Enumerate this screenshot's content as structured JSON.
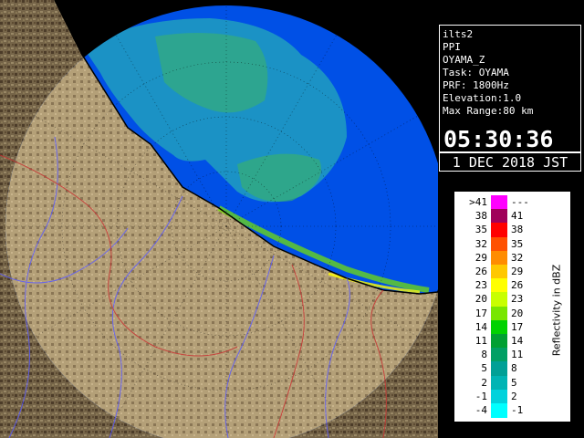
{
  "info": {
    "radar_name": "ilts2",
    "scan_type": "PPI",
    "product": "OYAMA_Z",
    "task": "Task: OYAMA",
    "prf": "PRF: 1800Hz",
    "elevation": "Elevation:1.0",
    "max_range": "Max Range:80 km",
    "time": "05:30:36",
    "date": "1 DEC 2018 JST"
  },
  "legend": {
    "title": "Reflectivity in dBZ",
    "rows": [
      {
        "left": ">41",
        "right": "---",
        "color": "#ff00ff"
      },
      {
        "left": "38",
        "right": "41",
        "color": "#a0005a"
      },
      {
        "left": "35",
        "right": "38",
        "color": "#ff0000"
      },
      {
        "left": "32",
        "right": "35",
        "color": "#ff5000"
      },
      {
        "left": "29",
        "right": "32",
        "color": "#ff8c00"
      },
      {
        "left": "26",
        "right": "29",
        "color": "#ffc800"
      },
      {
        "left": "23",
        "right": "26",
        "color": "#ffff00"
      },
      {
        "left": "20",
        "right": "23",
        "color": "#c8ff00"
      },
      {
        "left": "17",
        "right": "20",
        "color": "#78e600"
      },
      {
        "left": "14",
        "right": "17",
        "color": "#00d200"
      },
      {
        "left": "11",
        "right": "14",
        "color": "#00a032"
      },
      {
        "left": "8",
        "right": "11",
        "color": "#00a064"
      },
      {
        "left": "5",
        "right": "8",
        "color": "#00a096"
      },
      {
        "left": "2",
        "right": "5",
        "color": "#00b4b4"
      },
      {
        "left": "-1",
        "right": "2",
        "color": "#00d2dc"
      },
      {
        "left": "-4",
        "right": "-1",
        "color": "#00ffff"
      }
    ]
  },
  "colors": {
    "sea": "#0050e6",
    "land_dark": "#5a4630",
    "land_light": "#a08c64",
    "coastline": "#000000",
    "river": "#5a5aff",
    "boundary": "#c83232",
    "echo_weak": "#32c8aa",
    "echo_mid": "#3cb464"
  }
}
